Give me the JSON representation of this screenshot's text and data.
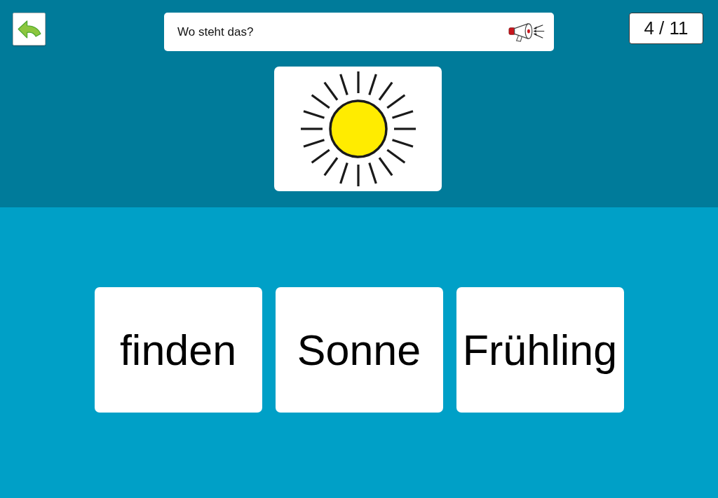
{
  "prompt": {
    "text": "Wo steht das?"
  },
  "counter": "4 / 11",
  "choices": [
    {
      "word": "finden"
    },
    {
      "word": "Sonne"
    },
    {
      "word": "Frühling"
    }
  ]
}
